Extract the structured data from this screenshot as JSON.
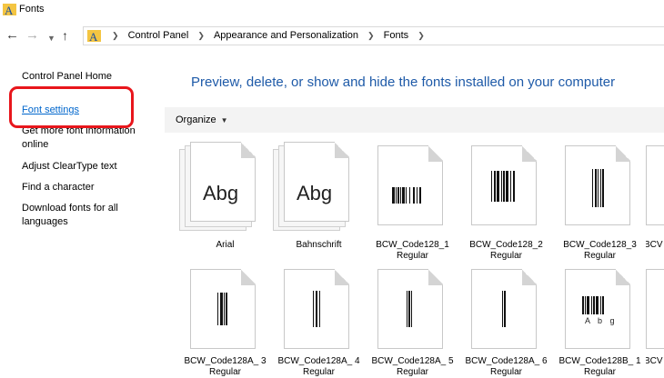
{
  "window": {
    "title": "Fonts",
    "accent": "#0066cc"
  },
  "nav": {
    "back_icon": "back-arrow-icon",
    "forward_icon": "forward-arrow-icon",
    "recent_icon": "chevron-down-icon",
    "up_icon": "up-arrow-icon",
    "breadcrumbs": [
      "Control Panel",
      "Appearance and Personalization",
      "Fonts"
    ]
  },
  "left_pane": {
    "home": "Control Panel Home",
    "links": [
      {
        "label": "Font settings",
        "style": "blue"
      },
      {
        "label": "Get more font information online",
        "style": "normal"
      },
      {
        "label": "Adjust ClearType text",
        "style": "normal"
      },
      {
        "label": "Find a character",
        "style": "normal"
      },
      {
        "label": "Download fonts for all languages",
        "style": "normal"
      }
    ],
    "highlight_color": "#e8161c"
  },
  "main": {
    "heading": "Preview, delete, or show and hide the fonts installed on your computer",
    "heading_color": "#1e5aa8",
    "toolbar": {
      "organize_label": "Organize"
    },
    "fonts_row1": [
      {
        "name": "Arial",
        "preview": "Abg",
        "kind": "stack"
      },
      {
        "name": "Bahnschrift",
        "preview": "Abg",
        "kind": "stack"
      },
      {
        "name": "BCW_Code128_1 Regular",
        "kind": "barcode"
      },
      {
        "name": "BCW_Code128_2 Regular",
        "kind": "barcode"
      },
      {
        "name": "BCW_Code128_3 Regular",
        "kind": "barcode"
      },
      {
        "name": "BCV",
        "kind": "partial"
      }
    ],
    "fonts_row2": [
      {
        "name": "BCW_Code128A_ 3 Regular",
        "kind": "barcode"
      },
      {
        "name": "BCW_Code128A_ 4 Regular",
        "kind": "barcode"
      },
      {
        "name": "BCW_Code128A_ 5 Regular",
        "kind": "barcode"
      },
      {
        "name": "BCW_Code128A_ 6 Regular",
        "kind": "barcode"
      },
      {
        "name": "BCW_Code128B_ 1 Regular",
        "kind": "barcode",
        "sample": "A b g"
      },
      {
        "name": "BCV",
        "kind": "partial"
      }
    ]
  }
}
